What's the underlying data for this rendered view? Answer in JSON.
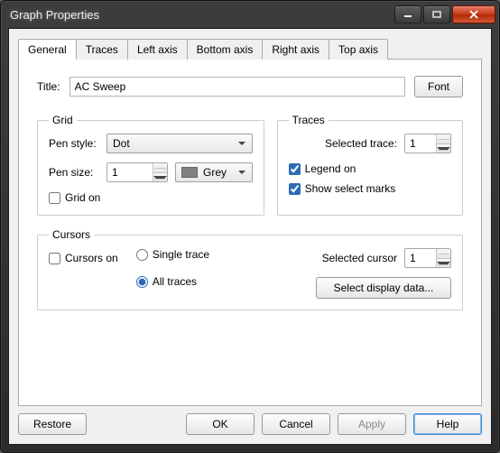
{
  "window": {
    "title": "Graph Properties"
  },
  "tabs": [
    "General",
    "Traces",
    "Left axis",
    "Bottom axis",
    "Right axis",
    "Top axis"
  ],
  "title_row": {
    "label": "Title:",
    "value": "AC Sweep",
    "font_btn": "Font"
  },
  "grid": {
    "legend": "Grid",
    "pen_style_label": "Pen style:",
    "pen_style_value": "Dot",
    "pen_size_label": "Pen size:",
    "pen_size_value": "1",
    "pen_color_value": "Grey",
    "grid_on_label": "Grid on"
  },
  "traces": {
    "legend": "Traces",
    "selected_label": "Selected trace:",
    "selected_value": "1",
    "legend_on_label": "Legend on",
    "show_marks_label": "Show select marks"
  },
  "cursors": {
    "legend": "Cursors",
    "cursors_on_label": "Cursors on",
    "single_label": "Single trace",
    "all_label": "All traces",
    "selected_label": "Selected cursor",
    "selected_value": "1",
    "display_btn": "Select display data..."
  },
  "buttons": {
    "restore": "Restore",
    "ok": "OK",
    "cancel": "Cancel",
    "apply": "Apply",
    "help": "Help"
  }
}
